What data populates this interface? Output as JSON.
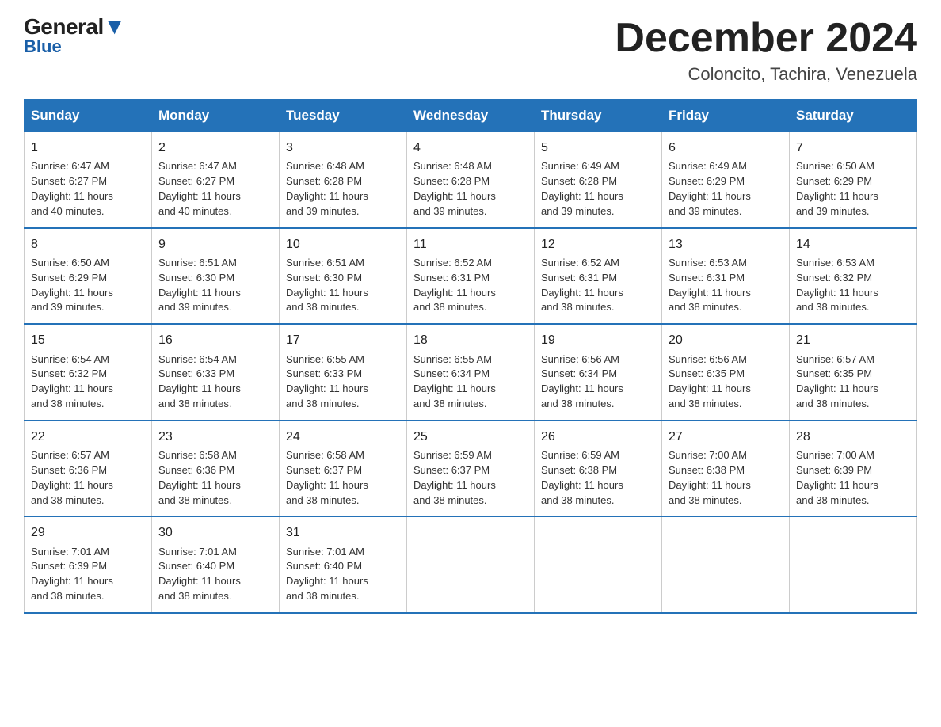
{
  "logo": {
    "part1": "General",
    "part2": "Blue"
  },
  "title": "December 2024",
  "subtitle": "Coloncito, Tachira, Venezuela",
  "days_of_week": [
    "Sunday",
    "Monday",
    "Tuesday",
    "Wednesday",
    "Thursday",
    "Friday",
    "Saturday"
  ],
  "weeks": [
    [
      {
        "day": "1",
        "info": "Sunrise: 6:47 AM\nSunset: 6:27 PM\nDaylight: 11 hours\nand 40 minutes."
      },
      {
        "day": "2",
        "info": "Sunrise: 6:47 AM\nSunset: 6:27 PM\nDaylight: 11 hours\nand 40 minutes."
      },
      {
        "day": "3",
        "info": "Sunrise: 6:48 AM\nSunset: 6:28 PM\nDaylight: 11 hours\nand 39 minutes."
      },
      {
        "day": "4",
        "info": "Sunrise: 6:48 AM\nSunset: 6:28 PM\nDaylight: 11 hours\nand 39 minutes."
      },
      {
        "day": "5",
        "info": "Sunrise: 6:49 AM\nSunset: 6:28 PM\nDaylight: 11 hours\nand 39 minutes."
      },
      {
        "day": "6",
        "info": "Sunrise: 6:49 AM\nSunset: 6:29 PM\nDaylight: 11 hours\nand 39 minutes."
      },
      {
        "day": "7",
        "info": "Sunrise: 6:50 AM\nSunset: 6:29 PM\nDaylight: 11 hours\nand 39 minutes."
      }
    ],
    [
      {
        "day": "8",
        "info": "Sunrise: 6:50 AM\nSunset: 6:29 PM\nDaylight: 11 hours\nand 39 minutes."
      },
      {
        "day": "9",
        "info": "Sunrise: 6:51 AM\nSunset: 6:30 PM\nDaylight: 11 hours\nand 39 minutes."
      },
      {
        "day": "10",
        "info": "Sunrise: 6:51 AM\nSunset: 6:30 PM\nDaylight: 11 hours\nand 38 minutes."
      },
      {
        "day": "11",
        "info": "Sunrise: 6:52 AM\nSunset: 6:31 PM\nDaylight: 11 hours\nand 38 minutes."
      },
      {
        "day": "12",
        "info": "Sunrise: 6:52 AM\nSunset: 6:31 PM\nDaylight: 11 hours\nand 38 minutes."
      },
      {
        "day": "13",
        "info": "Sunrise: 6:53 AM\nSunset: 6:31 PM\nDaylight: 11 hours\nand 38 minutes."
      },
      {
        "day": "14",
        "info": "Sunrise: 6:53 AM\nSunset: 6:32 PM\nDaylight: 11 hours\nand 38 minutes."
      }
    ],
    [
      {
        "day": "15",
        "info": "Sunrise: 6:54 AM\nSunset: 6:32 PM\nDaylight: 11 hours\nand 38 minutes."
      },
      {
        "day": "16",
        "info": "Sunrise: 6:54 AM\nSunset: 6:33 PM\nDaylight: 11 hours\nand 38 minutes."
      },
      {
        "day": "17",
        "info": "Sunrise: 6:55 AM\nSunset: 6:33 PM\nDaylight: 11 hours\nand 38 minutes."
      },
      {
        "day": "18",
        "info": "Sunrise: 6:55 AM\nSunset: 6:34 PM\nDaylight: 11 hours\nand 38 minutes."
      },
      {
        "day": "19",
        "info": "Sunrise: 6:56 AM\nSunset: 6:34 PM\nDaylight: 11 hours\nand 38 minutes."
      },
      {
        "day": "20",
        "info": "Sunrise: 6:56 AM\nSunset: 6:35 PM\nDaylight: 11 hours\nand 38 minutes."
      },
      {
        "day": "21",
        "info": "Sunrise: 6:57 AM\nSunset: 6:35 PM\nDaylight: 11 hours\nand 38 minutes."
      }
    ],
    [
      {
        "day": "22",
        "info": "Sunrise: 6:57 AM\nSunset: 6:36 PM\nDaylight: 11 hours\nand 38 minutes."
      },
      {
        "day": "23",
        "info": "Sunrise: 6:58 AM\nSunset: 6:36 PM\nDaylight: 11 hours\nand 38 minutes."
      },
      {
        "day": "24",
        "info": "Sunrise: 6:58 AM\nSunset: 6:37 PM\nDaylight: 11 hours\nand 38 minutes."
      },
      {
        "day": "25",
        "info": "Sunrise: 6:59 AM\nSunset: 6:37 PM\nDaylight: 11 hours\nand 38 minutes."
      },
      {
        "day": "26",
        "info": "Sunrise: 6:59 AM\nSunset: 6:38 PM\nDaylight: 11 hours\nand 38 minutes."
      },
      {
        "day": "27",
        "info": "Sunrise: 7:00 AM\nSunset: 6:38 PM\nDaylight: 11 hours\nand 38 minutes."
      },
      {
        "day": "28",
        "info": "Sunrise: 7:00 AM\nSunset: 6:39 PM\nDaylight: 11 hours\nand 38 minutes."
      }
    ],
    [
      {
        "day": "29",
        "info": "Sunrise: 7:01 AM\nSunset: 6:39 PM\nDaylight: 11 hours\nand 38 minutes."
      },
      {
        "day": "30",
        "info": "Sunrise: 7:01 AM\nSunset: 6:40 PM\nDaylight: 11 hours\nand 38 minutes."
      },
      {
        "day": "31",
        "info": "Sunrise: 7:01 AM\nSunset: 6:40 PM\nDaylight: 11 hours\nand 38 minutes."
      },
      {
        "day": "",
        "info": ""
      },
      {
        "day": "",
        "info": ""
      },
      {
        "day": "",
        "info": ""
      },
      {
        "day": "",
        "info": ""
      }
    ]
  ]
}
